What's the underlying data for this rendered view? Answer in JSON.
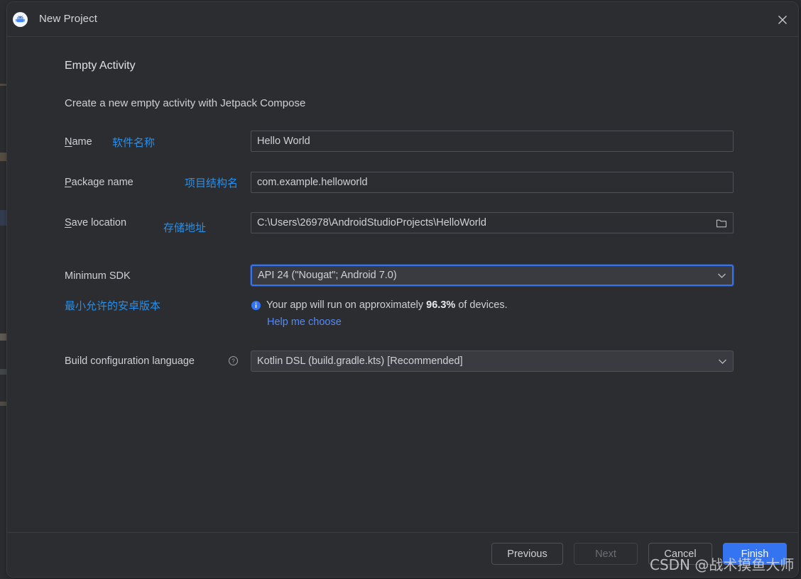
{
  "window": {
    "title": "New Project",
    "app_icon": "android-studio-icon",
    "close_icon": "close-icon"
  },
  "content": {
    "heading": "Empty Activity",
    "subheading": "Create a new empty activity with Jetpack Compose"
  },
  "fields": {
    "name": {
      "label_mnemonic": "N",
      "label_rest": "ame",
      "annotation": "软件名称",
      "value": "Hello World"
    },
    "package_name": {
      "label_mnemonic": "P",
      "label_rest": "ackage name",
      "annotation": "项目结构名",
      "value": "com.example.helloworld"
    },
    "save_location": {
      "label_mnemonic": "S",
      "label_rest": "ave location",
      "annotation": "存储地址",
      "value": "C:\\Users\\26978\\AndroidStudioProjects\\HelloWorld",
      "browse_icon": "folder-icon"
    },
    "minimum_sdk": {
      "label": "Minimum SDK",
      "annotation": "最小允许的安卓版本",
      "value": "API 24 (\"Nougat\"; Android 7.0)",
      "dropdown_icon": "chevron-down-icon",
      "focused": true
    },
    "build_config_language": {
      "label": "Build configuration language",
      "help_icon": "question-mark-circle-icon",
      "value": "Kotlin DSL (build.gradle.kts) [Recommended]",
      "dropdown_icon": "chevron-down-icon"
    }
  },
  "info": {
    "icon": "info-circle-icon",
    "text_before": "Your app will run on approximately",
    "percent": "96.3%",
    "text_after": "of devices.",
    "link": "Help me choose"
  },
  "buttons": {
    "previous": "Previous",
    "next": "Next",
    "cancel": "Cancel",
    "finish": "Finish"
  },
  "watermark": "CSDN @战术摸鱼大师",
  "colors": {
    "dialog_bg": "#2b2d30",
    "field_border": "#4e5157",
    "accent_blue": "#3574f0",
    "link_blue": "#548af7",
    "annotation_blue": "#2a8fe8",
    "text_primary": "#ced0d6"
  }
}
